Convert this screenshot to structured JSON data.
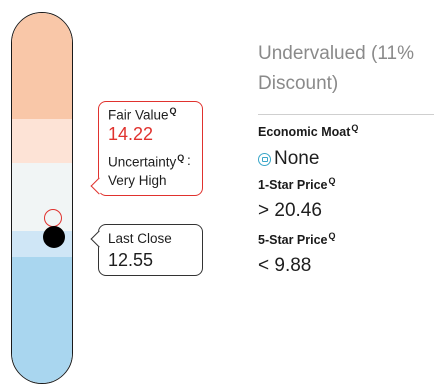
{
  "fair_value": {
    "label": "Fair Value",
    "info_icon": "Q",
    "value": "14.22",
    "uncertainty_label": "Uncertainty",
    "uncertainty_colon": ":",
    "uncertainty_value": "Very High",
    "color": "#e0322e"
  },
  "last_close": {
    "label": "Last Close",
    "value": "12.55"
  },
  "valuation": {
    "line1": "Undervalued (11%",
    "line2": "Discount)"
  },
  "economic_moat": {
    "label": "Economic Moat",
    "info_icon": "Q",
    "value": "None",
    "icon": "moat-none-icon"
  },
  "one_star": {
    "label": "1-Star Price",
    "info_icon": "Q",
    "prefix": ">",
    "value": "20.46"
  },
  "five_star": {
    "label": "5-Star Price",
    "info_icon": "Q",
    "prefix": "<",
    "value": "9.88"
  },
  "colors": {
    "overvalued_band": "#f9c7a8",
    "fair_band": "#f1f5f5",
    "undervalued_band": "#a9d6ef",
    "fair_value_marker": "#e0322e",
    "last_close_marker": "#000000"
  }
}
